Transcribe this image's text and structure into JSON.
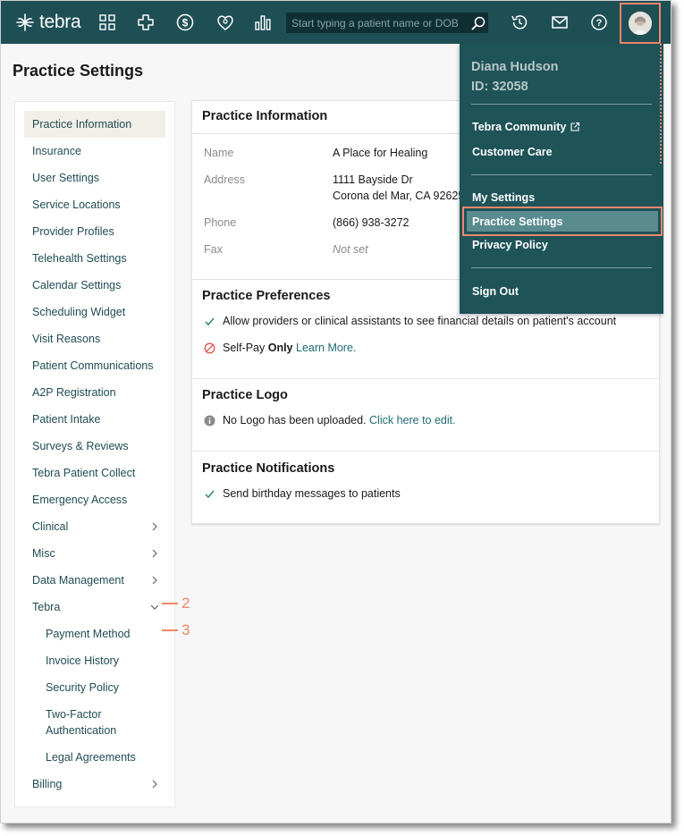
{
  "app": {
    "logo_text": "tebra",
    "brand_color": "#1e4f55",
    "accent_color": "#f0876a"
  },
  "topbar": {
    "icons": [
      "apps-grid-icon",
      "clinical-cross-icon",
      "dollar-icon",
      "patient-heart-icon",
      "reports-bar-icon"
    ],
    "search_placeholder": "Start typing a patient name or DOB",
    "right_icons": [
      "history-icon",
      "mail-icon",
      "help-icon"
    ]
  },
  "page": {
    "title": "Practice Settings"
  },
  "sidebar": {
    "items": [
      {
        "label": "Practice Information",
        "active": true
      },
      {
        "label": "Insurance"
      },
      {
        "label": "User Settings"
      },
      {
        "label": "Service Locations"
      },
      {
        "label": "Provider Profiles"
      },
      {
        "label": "Telehealth Settings"
      },
      {
        "label": "Calendar Settings"
      },
      {
        "label": "Scheduling Widget"
      },
      {
        "label": "Visit Reasons"
      },
      {
        "label": "Patient Communications"
      },
      {
        "label": "A2P Registration"
      },
      {
        "label": "Patient Intake"
      },
      {
        "label": "Surveys & Reviews"
      },
      {
        "label": "Tebra Patient Collect"
      },
      {
        "label": "Emergency Access"
      },
      {
        "label": "Clinical",
        "chevron": "right"
      },
      {
        "label": "Misc",
        "chevron": "right"
      },
      {
        "label": "Data Management",
        "chevron": "right"
      },
      {
        "label": "Tebra",
        "chevron": "down"
      },
      {
        "label": "Payment Method",
        "sub": true
      },
      {
        "label": "Invoice History",
        "sub": true
      },
      {
        "label": "Security Policy",
        "sub": true
      },
      {
        "label": "Two-Factor",
        "label2": "Authentication",
        "sub": true
      },
      {
        "label": "Legal Agreements",
        "sub": true
      },
      {
        "label": "Billing",
        "chevron": "right"
      }
    ]
  },
  "callouts": [
    "2",
    "3"
  ],
  "practice_info": {
    "title": "Practice Information",
    "fields": [
      {
        "label": "Name",
        "value": "A Place for Healing"
      },
      {
        "label": "Address",
        "value": "1111 Bayside Dr",
        "value2": "Corona del Mar, CA 92625"
      },
      {
        "label": "Phone",
        "value": "(866) 938-3272"
      },
      {
        "label": "Fax",
        "value": "Not set"
      }
    ]
  },
  "preferences": {
    "title": "Practice Preferences",
    "allow_text": "Allow providers or clinical assistants to see financial details on patient's account",
    "selfpay_prefix": "Self-Pay ",
    "selfpay_bold": "Only",
    "selfpay_link": "Learn More."
  },
  "logo_section": {
    "title": "Practice Logo",
    "text": "No Logo has been uploaded. ",
    "link": "Click here to edit."
  },
  "notifications": {
    "title": "Practice Notifications",
    "text": "Send birthday messages to patients"
  },
  "user_menu": {
    "name": "Diana Hudson",
    "id": "ID: 32058",
    "items": [
      "Tebra Community",
      "Customer Care",
      "My Settings",
      "Practice Settings",
      "Privacy Policy",
      "Sign Out"
    ]
  }
}
